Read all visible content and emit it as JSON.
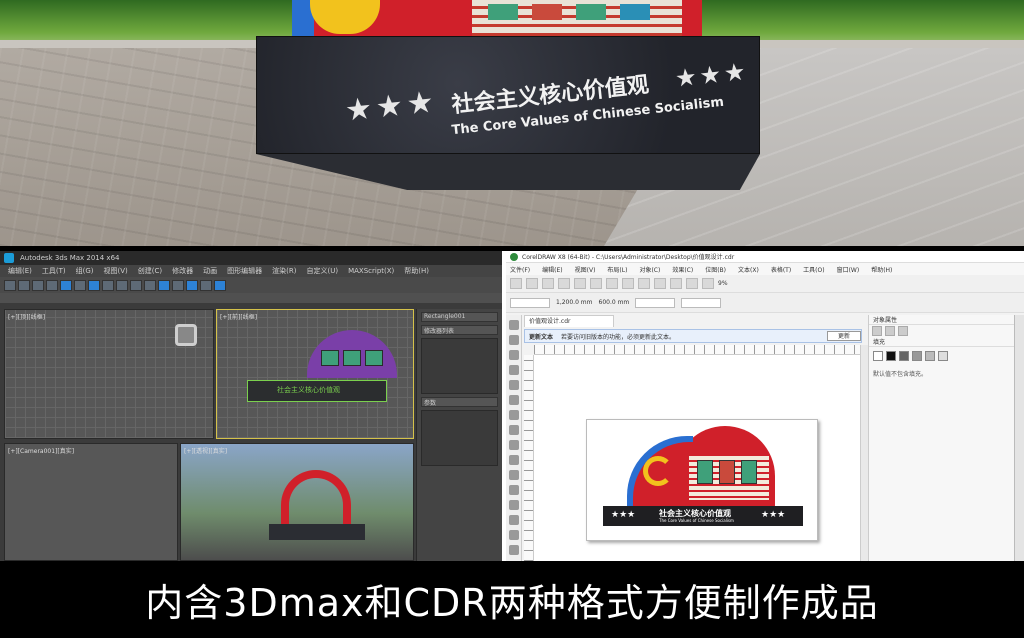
{
  "render": {
    "sign_title_cn": "社会主义核心价值观",
    "sign_title_en": "The Core Values of Chinese Socialism",
    "stars_left": "★★★",
    "stars_right": "★★★"
  },
  "max": {
    "title": "Autodesk 3ds Max 2014 x64",
    "menus": [
      "编辑(E)",
      "工具(T)",
      "组(G)",
      "视图(V)",
      "创建(C)",
      "修改器",
      "动画",
      "图形编辑器",
      "渲染(R)",
      "自定义(U)",
      "MAXScript(X)",
      "帮助(H)"
    ],
    "viewport_top_label": "[+][顶][线框]",
    "viewport_front_label": "[+][前][线框]",
    "viewport_left_label": "[+][Camera001][真实]",
    "viewport_persp_label": "[+][透视][真实]",
    "panel_object": "Rectangle001",
    "panel_modifier": "修改器列表",
    "panel_params": "参数",
    "front_text": "社会主义核心价值观"
  },
  "cdr": {
    "title": "CorelDRAW X8 (64-Bit) - C:\\Users\\Administrator\\Desktop\\价值观设计.cdr",
    "menus": [
      "文件(F)",
      "编辑(E)",
      "视图(V)",
      "布局(L)",
      "对象(C)",
      "效果(C)",
      "位图(B)",
      "文本(X)",
      "表格(T)",
      "工具(O)",
      "窗口(W)",
      "帮助(H)"
    ],
    "doc_tab": "价值观设计.cdr",
    "infobar_title": "更新文本",
    "infobar_msg": "若要访问旧版本的功能，必须更新此文本。",
    "infobar_button": "更新",
    "zoom": "9%",
    "size_w": "1,200.0 mm",
    "size_h": "600.0 mm",
    "docker_title": "对象属性",
    "docker_section": "填充",
    "docker_msg": "默认值不包含填充。",
    "sign_cn": "社会主义核心价值观",
    "sign_en": "The Core Values of Chinese Socialism",
    "sign_stars": "★★★"
  },
  "caption": "内含3Dmax和CDR两种格式方便制作成品",
  "colors": {
    "party_red": "#d0202a",
    "gold": "#f2c21d",
    "blue": "#2a6fd1",
    "stone": "#2b2d33"
  }
}
